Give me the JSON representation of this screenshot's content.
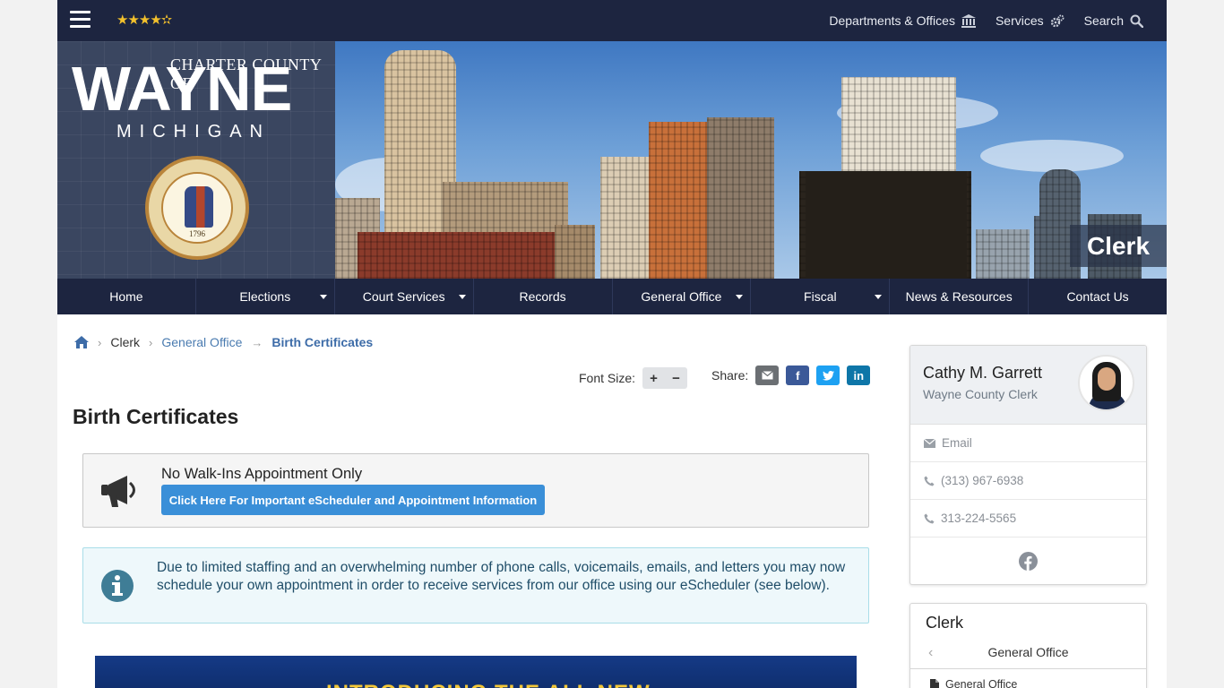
{
  "topbar": {
    "rating_stars": "★★★★✫",
    "departments_label": "Departments & Offices",
    "services_label": "Services",
    "search_label": "Search"
  },
  "banner": {
    "logo_charter": "CHARTER COUNTY OF",
    "logo_wayne": "WAYNE",
    "logo_michigan": "MICHIGAN",
    "seal_year": "1796",
    "page_label": "Clerk"
  },
  "mainnav": {
    "items": [
      {
        "label": "Home"
      },
      {
        "label": "Elections"
      },
      {
        "label": "Court Services"
      },
      {
        "label": "Records"
      },
      {
        "label": "General Office"
      },
      {
        "label": "Fiscal"
      },
      {
        "label": "News & Resources"
      },
      {
        "label": "Contact Us"
      }
    ]
  },
  "breadcrumb": {
    "items": [
      "Clerk",
      "General Office",
      "Birth Certificates"
    ]
  },
  "tools": {
    "font_size_label": "Font Size:",
    "increase": "+",
    "decrease": "−",
    "share_label": "Share:"
  },
  "main": {
    "title": "Birth Certificates",
    "notice_title": "No Walk-Ins Appointment Only",
    "notice_button": "Click Here For Important eScheduler and Appointment Information",
    "info_text": "Due to limited staffing and an overwhelming number of phone calls, voicemails, emails, and letters you may now schedule your own appointment in order to receive services from our office using our eScheduler (see below).",
    "promo_text": "INTRODUCING THE ALL NEW"
  },
  "sidebar": {
    "contact": {
      "name": "Cathy M. Garrett",
      "title": "Wayne County Clerk",
      "email_label": "Email",
      "phone_1": "(313) 967-6938",
      "phone_2": "313-224-5565"
    },
    "nav": {
      "title": "Clerk",
      "current": "General Office",
      "first_item": "General Office"
    }
  },
  "colors": {
    "navy": "#1d2540",
    "accent_blue": "#3a8fd8",
    "link_blue": "#4a7bb0",
    "star_gold": "#f3c12c",
    "info_text": "#1f4d68"
  },
  "icons": [
    "hamburger-icon",
    "building-icon",
    "gears-icon",
    "search-icon",
    "home-icon",
    "megaphone-icon",
    "info-icon",
    "envelope-icon",
    "phone-icon",
    "facebook-icon",
    "document-icon"
  ]
}
